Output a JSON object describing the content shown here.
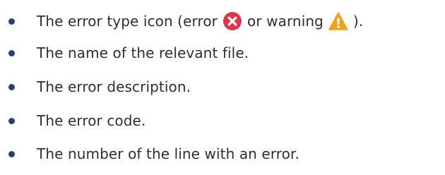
{
  "bullets": [
    {
      "parts": {
        "before_error": "The error type icon (error",
        "between": "or warning",
        "after_warning": ")."
      },
      "icons": {
        "error": "error-icon",
        "warning": "warning-icon"
      }
    },
    {
      "text": "The name of the relevant file."
    },
    {
      "text": "The error description."
    },
    {
      "text": "The error code."
    },
    {
      "text": "The number of the line with an error."
    }
  ],
  "colors": {
    "text": "#2e2e2e",
    "bullet": "#2a3f6e",
    "error_icon": "#e0344a",
    "warning_icon": "#f5a21b"
  }
}
